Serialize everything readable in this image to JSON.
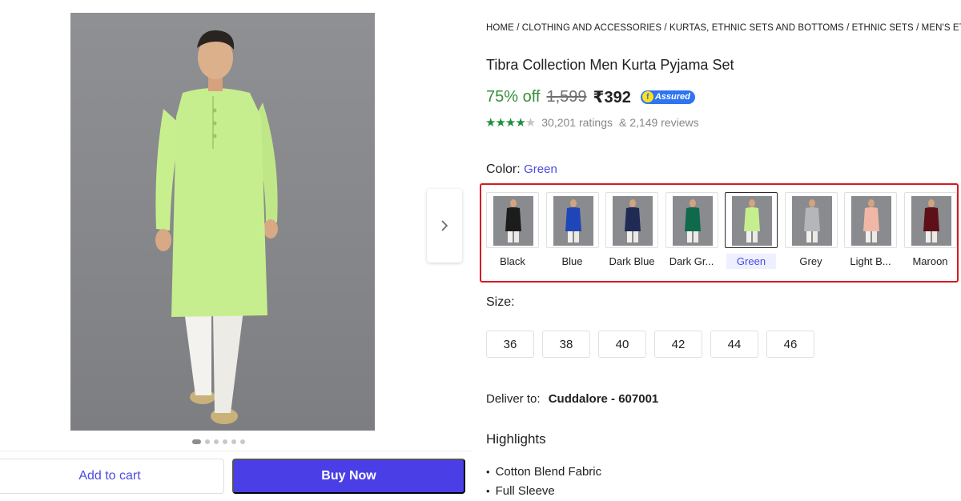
{
  "breadcrumb": "HOME / CLOTHING AND ACCESSORIES / KURTAS, ETHNIC SETS AND BOTTOMS / ETHNIC SETS / MEN'S ETHNIC SETS",
  "product": {
    "title": "Tibra Collection Men Kurta Pyjama Set",
    "discount": "75% off",
    "mrp": "1,599",
    "price": "₹392",
    "assured_label": "Assured",
    "rating_stars": 4.5,
    "ratings": "30,201 ratings",
    "reviews": "& 2,149 reviews"
  },
  "color": {
    "label": "Color:",
    "selected": "Green",
    "swatches": [
      {
        "name": "Black",
        "hex": "#1c1c1c"
      },
      {
        "name": "Blue",
        "hex": "#1f46b8"
      },
      {
        "name": "Dark Blue",
        "hex": "#1f2a55"
      },
      {
        "name": "Dark Gr...",
        "hex": "#0e6a4a"
      },
      {
        "name": "Green",
        "hex": "#c6ee8e"
      },
      {
        "name": "Grey",
        "hex": "#b4b6b9"
      },
      {
        "name": "Light B...",
        "hex": "#f0b7a6"
      },
      {
        "name": "Maroon",
        "hex": "#5e1018"
      }
    ]
  },
  "size": {
    "label": "Size:",
    "options": [
      "36",
      "38",
      "40",
      "42",
      "44",
      "46"
    ]
  },
  "delivery": {
    "label": "Deliver to:",
    "location": "Cuddalore - 607001"
  },
  "highlights": {
    "title": "Highlights",
    "items": [
      "Cotton Blend Fabric",
      "Full Sleeve"
    ]
  },
  "actions": {
    "add_to_cart": "Add to cart",
    "buy_now": "Buy Now"
  },
  "colors": {
    "accent": "#4a3fe6",
    "discount_green": "#388e3c",
    "star_green": "#1e8e3e",
    "highlight_red": "#d71920",
    "assured_blue": "#2f74f0"
  },
  "icons": {
    "next": "chevron-right-icon",
    "star": "star-icon",
    "assured": "assured-badge-icon"
  },
  "carousel": {
    "image_count": 6,
    "active_index": 0
  }
}
